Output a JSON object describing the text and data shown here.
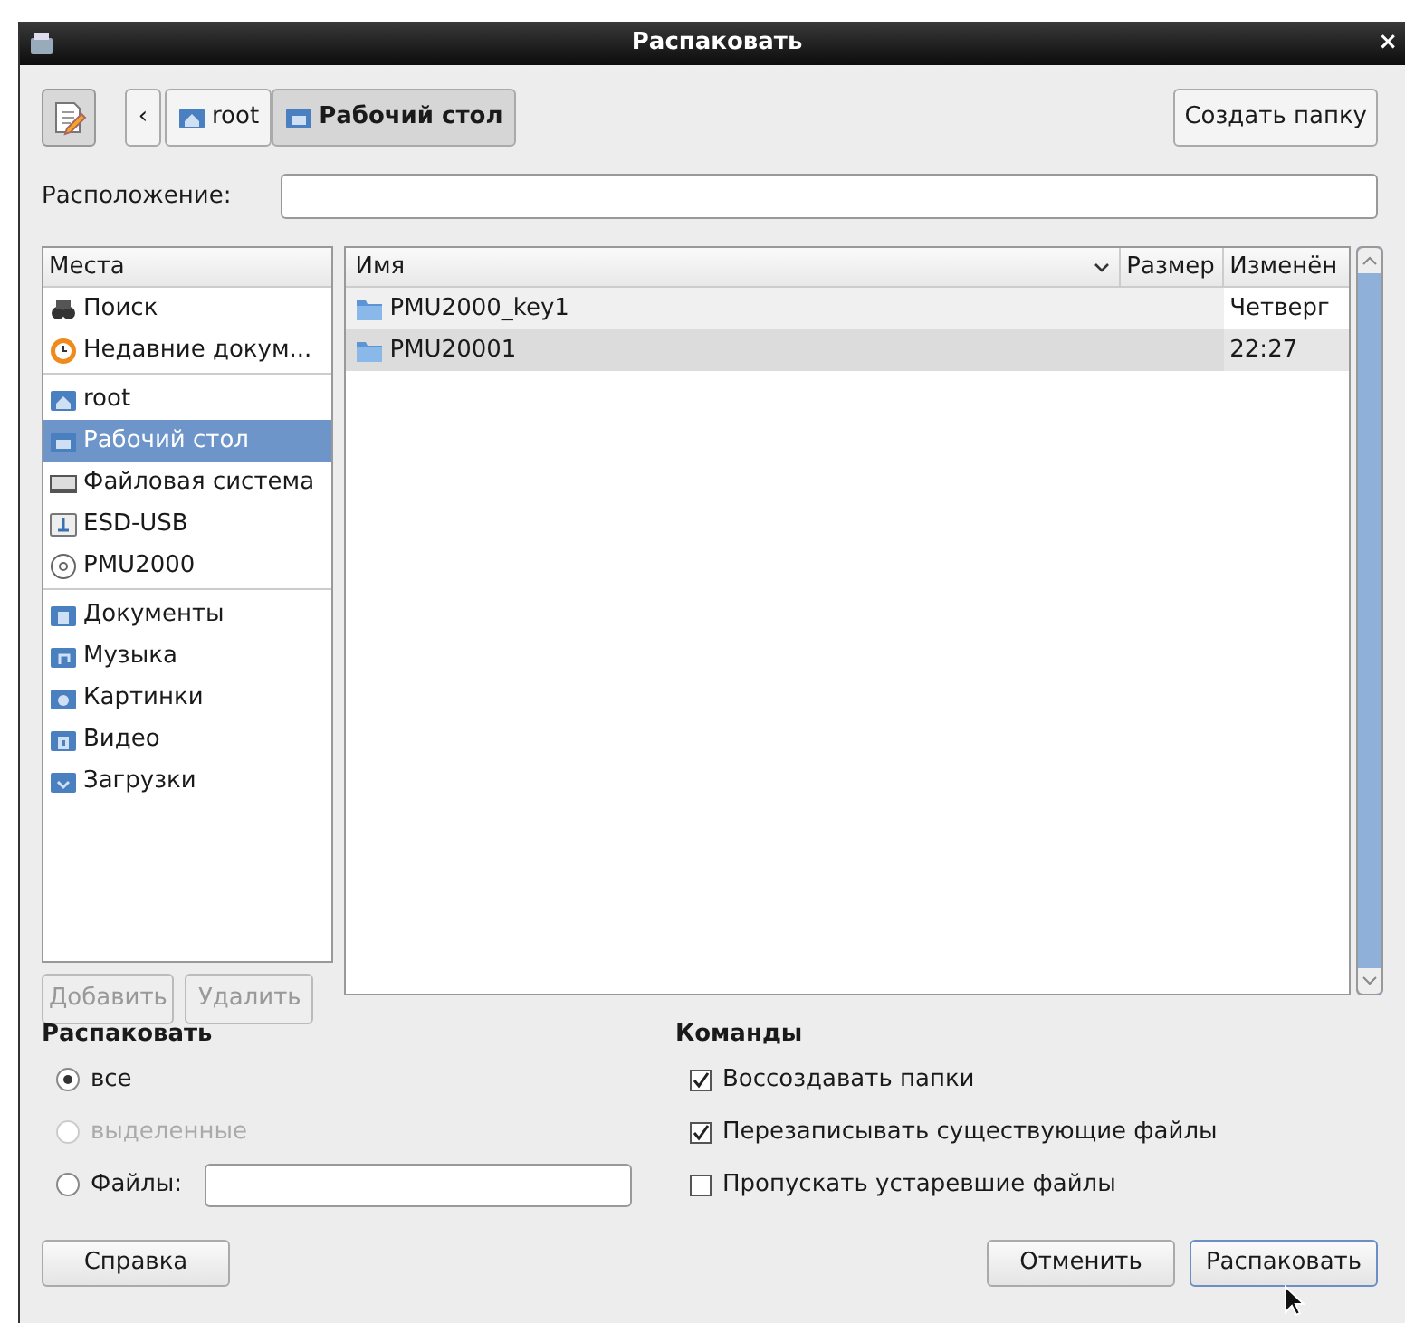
{
  "window": {
    "title": "Распаковать",
    "close": "×"
  },
  "toolbar": {
    "back": "‹",
    "path": [
      {
        "label": "root",
        "kind": "home",
        "selected": false
      },
      {
        "label": "Рабочий стол",
        "kind": "desktop",
        "selected": true
      }
    ],
    "create_folder": "Создать папку"
  },
  "location": {
    "label": "Расположение:"
  },
  "places": {
    "header": "Места",
    "groups": [
      {
        "items": [
          {
            "label": "Поиск",
            "kind": "search",
            "selected": false
          },
          {
            "label": "Недавние докум...",
            "kind": "recent",
            "selected": false
          }
        ]
      },
      {
        "items": [
          {
            "label": "root",
            "kind": "home",
            "selected": false
          },
          {
            "label": "Рабочий стол",
            "kind": "desktop",
            "selected": true
          },
          {
            "label": "Файловая система",
            "kind": "drive",
            "selected": false
          },
          {
            "label": "ESD-USB",
            "kind": "usb",
            "selected": false
          },
          {
            "label": "PMU2000",
            "kind": "disc",
            "selected": false
          }
        ]
      },
      {
        "items": [
          {
            "label": "Документы",
            "kind": "documents",
            "selected": false
          },
          {
            "label": "Музыка",
            "kind": "music",
            "selected": false
          },
          {
            "label": "Картинки",
            "kind": "pictures",
            "selected": false
          },
          {
            "label": "Видео",
            "kind": "video",
            "selected": false
          },
          {
            "label": "Загрузки",
            "kind": "downloads",
            "selected": false
          }
        ]
      }
    ],
    "add": "Добавить",
    "remove": "Удалить"
  },
  "files": {
    "columns": [
      "Имя",
      "Размер",
      "Изменён"
    ],
    "rows": [
      {
        "name": "PMU2000_key1",
        "modified": "Четверг",
        "selected": false
      },
      {
        "name": "PMU20001",
        "modified": "22:27",
        "selected": true
      }
    ]
  },
  "extract": {
    "heading": "Распаковать",
    "options": [
      {
        "label": "все",
        "selected": true,
        "disabled": false,
        "kind": "plain"
      },
      {
        "label": "выделенные",
        "selected": false,
        "disabled": true,
        "kind": "plain"
      },
      {
        "label": "Файлы:",
        "selected": false,
        "disabled": false,
        "kind": "field"
      }
    ]
  },
  "commands": {
    "heading": "Команды",
    "options": [
      {
        "label": "Воссоздавать папки",
        "checked": true
      },
      {
        "label": "Перезаписывать существующие файлы",
        "checked": true
      },
      {
        "label": "Пропускать устаревшие файлы",
        "checked": false
      }
    ]
  },
  "buttons": {
    "help": "Справка",
    "cancel": "Отменить",
    "ok": "Распаковать"
  }
}
